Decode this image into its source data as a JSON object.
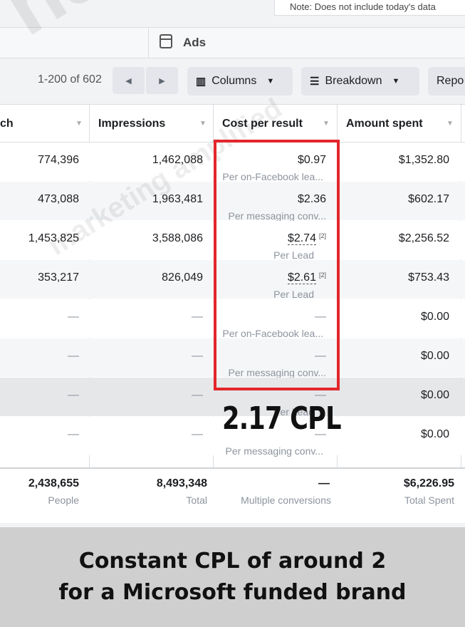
{
  "note": "Note: Does not include today's data",
  "ads_bar": {
    "label": "Ads"
  },
  "toolbar": {
    "pager_text": "1-200 of 602",
    "columns_label": "Columns",
    "breakdown_label": "Breakdown",
    "reports_label": "Repo"
  },
  "columns": {
    "reach": "ch",
    "impressions": "Impressions",
    "cost_per_result": "Cost per result",
    "amount_spent": "Amount spent"
  },
  "rows": [
    {
      "reach": "774,396",
      "impressions": "1,462,088",
      "cost": "$0.97",
      "cost_sub": "Per on-Facebook lea...",
      "spent": "$1,352.80"
    },
    {
      "reach": "473,088",
      "impressions": "1,963,481",
      "cost": "$2.36",
      "cost_sub": "Per messaging conv...",
      "spent": "$602.17"
    },
    {
      "reach": "1,453,825",
      "impressions": "3,588,086",
      "cost": "$2.74",
      "cost_sup": "[2]",
      "cost_sub": "Per Lead",
      "spent": "$2,256.52"
    },
    {
      "reach": "353,217",
      "impressions": "826,049",
      "cost": "$2.61",
      "cost_sup": "[2]",
      "cost_sub": "Per Lead",
      "spent": "$753.43"
    },
    {
      "reach": "—",
      "impressions": "—",
      "cost": "—",
      "cost_sub": "Per on-Facebook lea...",
      "spent": "$0.00"
    },
    {
      "reach": "—",
      "impressions": "—",
      "cost": "—",
      "cost_sub": "Per messaging conv...",
      "spent": "$0.00"
    },
    {
      "reach": "—",
      "impressions": "—",
      "cost": "—",
      "cost_sub": "Per Lead",
      "spent": "$0.00"
    },
    {
      "reach": "—",
      "impressions": "—",
      "cost": "—",
      "cost_sub": "Per messaging conv...",
      "spent": "$0.00"
    }
  ],
  "totals": {
    "reach": "2,438,655",
    "reach_sub": "People",
    "impressions": "8,493,348",
    "impressions_sub": "Total",
    "cost": "—",
    "cost_sub": "Multiple conversions",
    "spent": "$6,226.95",
    "spent_sub": "Total Spent"
  },
  "overlay": {
    "cpl": "2.17 CPL"
  },
  "watermark": {
    "line1": "nste",
    "line2": "marketing amplified"
  },
  "caption": {
    "line1": "Constant CPL of around 2",
    "line2": "for a Microsoft funded brand"
  },
  "colors": {
    "highlight": "#e3262b",
    "caption_bg": "#cfcfcf"
  }
}
